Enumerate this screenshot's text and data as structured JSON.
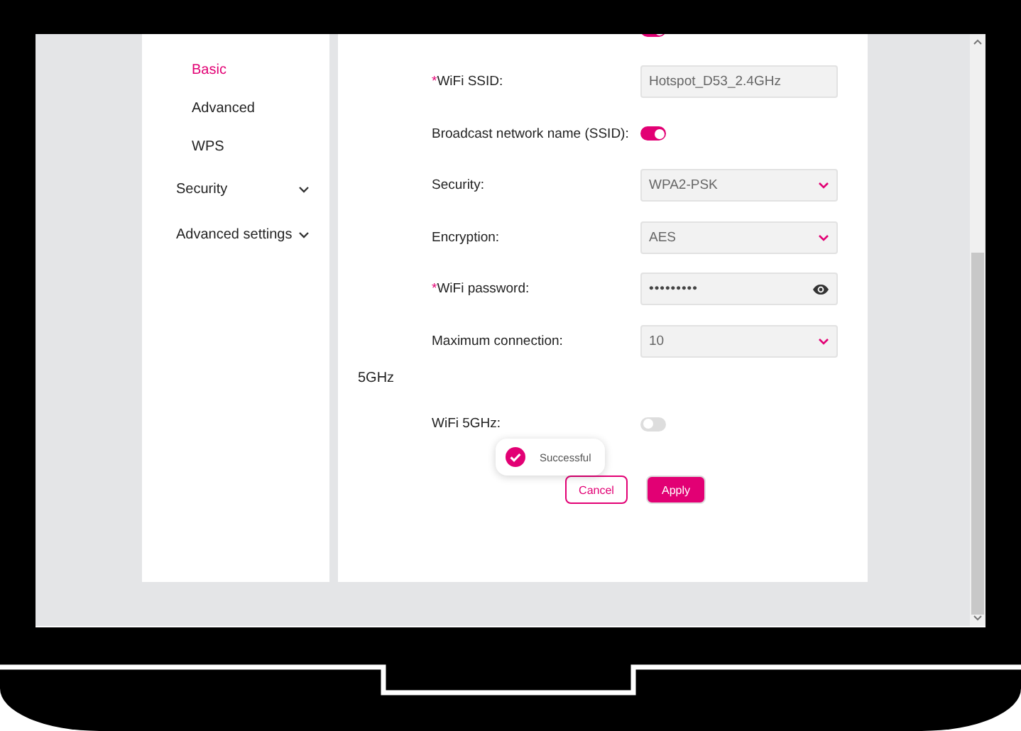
{
  "sidebar": {
    "items": [
      {
        "label": "Basic",
        "kind": "sub",
        "selected": true
      },
      {
        "label": "Advanced",
        "kind": "sub",
        "selected": false
      },
      {
        "label": "WPS",
        "kind": "sub",
        "selected": false
      },
      {
        "label": "Security",
        "kind": "group",
        "expanded": false,
        "selected": false
      },
      {
        "label": "Advanced settings",
        "kind": "group",
        "expanded": false,
        "selected": false
      }
    ]
  },
  "form": {
    "fields": [
      {
        "kind": "toggle",
        "on": true
      },
      {
        "kind": "text",
        "label": "WiFi SSID:",
        "required_mark": "*",
        "value": "Hotspot_D53_2.4GHz"
      },
      {
        "kind": "toggle",
        "label": "Broadcast network name (SSID):",
        "on": true
      },
      {
        "kind": "select",
        "label": "Security:",
        "value": "WPA2-PSK"
      },
      {
        "kind": "select",
        "label": "Encryption:",
        "value": "AES"
      },
      {
        "kind": "password",
        "label": "WiFi password:",
        "required_mark": "*",
        "value": "•••••••••"
      },
      {
        "kind": "select",
        "label": "Maximum connection:",
        "value": "10"
      },
      {
        "kind": "heading",
        "label": "5GHz"
      },
      {
        "kind": "toggle",
        "label": "WiFi 5GHz:",
        "on": false
      }
    ],
    "buttons": [
      {
        "label": "Cancel",
        "kind": "secondary"
      },
      {
        "label": "Apply",
        "kind": "primary"
      }
    ]
  },
  "toast": {
    "text": "Successful"
  }
}
